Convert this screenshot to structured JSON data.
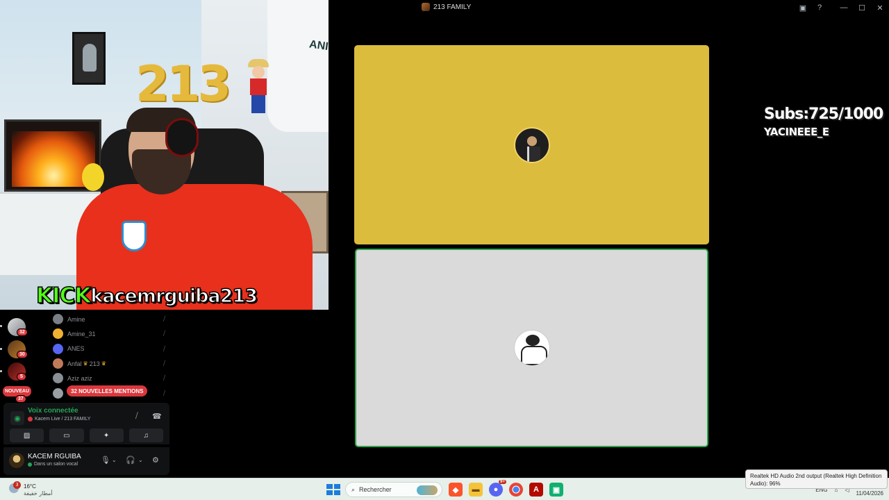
{
  "webcam": {
    "balloon_text": "213",
    "jersey_text": "ANIS",
    "kick_logo": "KICK",
    "kick_channel": "kacemrguiba213"
  },
  "window": {
    "title": "213 FAMILY"
  },
  "titlebar_icons": [
    "screen-share-icon",
    "help-icon",
    "minimize-icon",
    "maximize-icon",
    "close-icon"
  ],
  "stage": {
    "tiles": [
      {
        "avatar": "suit-man-avatar",
        "bg": "#dbbc3c",
        "speaking": false
      },
      {
        "avatar": "sketch-avatar",
        "bg": "#dadada",
        "speaking": true
      }
    ]
  },
  "overlay": {
    "subs": "Subs:725/1000",
    "username": "YACINEEE_E"
  },
  "servers": [
    {
      "badge": "32"
    },
    {
      "badge": "30"
    },
    {
      "badge": "5"
    }
  ],
  "nouveau_badge": "NOUVEAU",
  "nouveau_count": "37",
  "members": [
    {
      "name": "Amine",
      "crowns": false,
      "color": "#7a7f86"
    },
    {
      "name": "Amine_31",
      "crowns": false,
      "color": "#f0b232"
    },
    {
      "name": "ANES",
      "crowns": false,
      "color": "#5865f2"
    },
    {
      "name": "Anfal",
      "crowns": true,
      "suffix": "213",
      "color": "#c07a5a"
    },
    {
      "name": "Aziz aziz",
      "crowns": false,
      "color": "#8a8f96"
    },
    {
      "name": "",
      "crowns": false,
      "color": "#9a9fa6"
    }
  ],
  "mentions_label": "32 NOUVELLES MENTIONS",
  "voice": {
    "status": "Voix connectée",
    "channel": "Kacem Live / 213 FAMILY"
  },
  "user": {
    "name": "KACEM RGUIBA",
    "status": "Dans un salon vocal"
  },
  "taskbar": {
    "weather_badge": "3",
    "temperature": "16°C",
    "condition": "أمطار خفيفة",
    "search_placeholder": "Rechercher",
    "discord_badge": "9+",
    "lang": "ENG",
    "date": "11/04/2026"
  },
  "tooltip": {
    "line1": "Realtek HD Audio 2nd output (Realtek High Definition",
    "line2": "Audio): 96%"
  }
}
